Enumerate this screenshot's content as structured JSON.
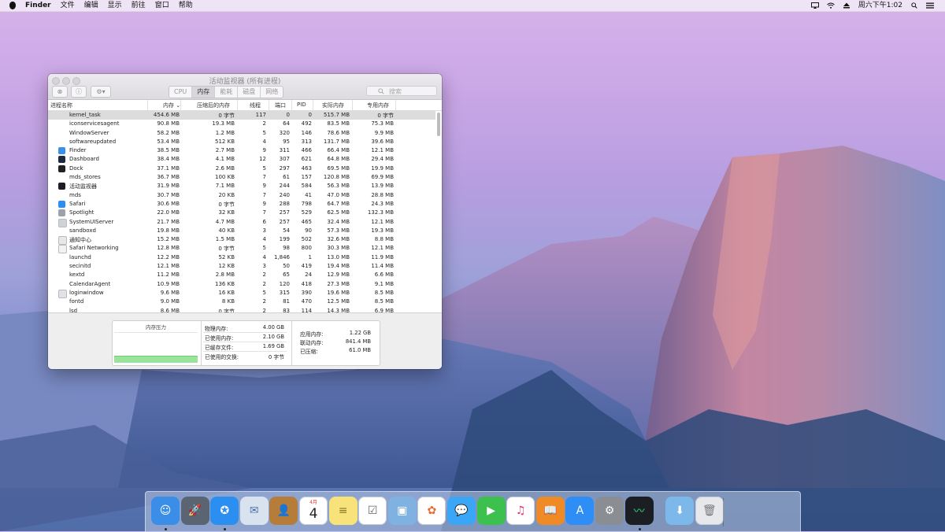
{
  "menubar": {
    "app_name": "Finder",
    "items": [
      "文件",
      "编辑",
      "显示",
      "前往",
      "窗口",
      "帮助"
    ],
    "clock": "周六下午1:02"
  },
  "window": {
    "title": "活动监视器 (所有进程)",
    "tabs": [
      {
        "label": "CPU",
        "active": false
      },
      {
        "label": "内存",
        "active": true
      },
      {
        "label": "能耗",
        "active": false
      },
      {
        "label": "磁盘",
        "active": false
      },
      {
        "label": "网络",
        "active": false
      }
    ],
    "search_placeholder": "搜索"
  },
  "table": {
    "columns": [
      "进程名称",
      "内存",
      "压缩后的内存",
      "线程",
      "端口",
      "PID",
      "实际内存",
      "专用内存"
    ],
    "rows": [
      {
        "name": "kernel_task",
        "mem": "454.6 MB",
        "comp": "0 字节",
        "threads": "117",
        "ports": "0",
        "pid": "0",
        "real": "515.7 MB",
        "priv": "0 字节",
        "selected": true,
        "icon": ""
      },
      {
        "name": "iconservicesagent",
        "mem": "90.8 MB",
        "comp": "19.3 MB",
        "threads": "2",
        "ports": "64",
        "pid": "492",
        "real": "83.5 MB",
        "priv": "75.3 MB",
        "icon": ""
      },
      {
        "name": "WindowServer",
        "mem": "58.2 MB",
        "comp": "1.2 MB",
        "threads": "5",
        "ports": "320",
        "pid": "146",
        "real": "78.6 MB",
        "priv": "9.9 MB",
        "icon": ""
      },
      {
        "name": "softwareupdated",
        "mem": "53.4 MB",
        "comp": "512 KB",
        "threads": "4",
        "ports": "95",
        "pid": "313",
        "real": "131.7 MB",
        "priv": "39.6 MB",
        "icon": ""
      },
      {
        "name": "Finder",
        "mem": "38.5 MB",
        "comp": "2.7 MB",
        "threads": "9",
        "ports": "311",
        "pid": "466",
        "real": "66.4 MB",
        "priv": "12.1 MB",
        "icon": "finder"
      },
      {
        "name": "Dashboard",
        "mem": "38.4 MB",
        "comp": "4.1 MB",
        "threads": "12",
        "ports": "307",
        "pid": "621",
        "real": "64.8 MB",
        "priv": "29.4 MB",
        "icon": "dashboard"
      },
      {
        "name": "Dock",
        "mem": "37.1 MB",
        "comp": "2.6 MB",
        "threads": "5",
        "ports": "297",
        "pid": "463",
        "real": "69.5 MB",
        "priv": "19.9 MB",
        "icon": "dock"
      },
      {
        "name": "mds_stores",
        "mem": "36.7 MB",
        "comp": "100 KB",
        "threads": "7",
        "ports": "61",
        "pid": "157",
        "real": "120.8 MB",
        "priv": "69.9 MB",
        "icon": ""
      },
      {
        "name": "活动监视器",
        "mem": "31.9 MB",
        "comp": "7.1 MB",
        "threads": "9",
        "ports": "244",
        "pid": "584",
        "real": "56.3 MB",
        "priv": "13.9 MB",
        "icon": "activity"
      },
      {
        "name": "mds",
        "mem": "30.7 MB",
        "comp": "20 KB",
        "threads": "7",
        "ports": "240",
        "pid": "41",
        "real": "47.0 MB",
        "priv": "28.8 MB",
        "icon": ""
      },
      {
        "name": "Safari",
        "mem": "30.6 MB",
        "comp": "0 字节",
        "threads": "9",
        "ports": "288",
        "pid": "798",
        "real": "64.7 MB",
        "priv": "24.3 MB",
        "icon": "safari"
      },
      {
        "name": "Spotlight",
        "mem": "22.0 MB",
        "comp": "32 KB",
        "threads": "7",
        "ports": "257",
        "pid": "529",
        "real": "62.5 MB",
        "priv": "132.3 MB",
        "icon": "spotlight"
      },
      {
        "name": "SystemUIServer",
        "mem": "21.7 MB",
        "comp": "4.7 MB",
        "threads": "6",
        "ports": "257",
        "pid": "465",
        "real": "32.4 MB",
        "priv": "12.1 MB",
        "icon": "system"
      },
      {
        "name": "sandboxd",
        "mem": "19.8 MB",
        "comp": "40 KB",
        "threads": "3",
        "ports": "54",
        "pid": "90",
        "real": "57.3 MB",
        "priv": "19.3 MB",
        "icon": ""
      },
      {
        "name": "通知中心",
        "mem": "15.2 MB",
        "comp": "1.5 MB",
        "threads": "4",
        "ports": "199",
        "pid": "502",
        "real": "32.6 MB",
        "priv": "8.8 MB",
        "icon": "notification"
      },
      {
        "name": "Safari Networking",
        "mem": "12.8 MB",
        "comp": "0 字节",
        "threads": "5",
        "ports": "98",
        "pid": "800",
        "real": "30.3 MB",
        "priv": "12.1 MB",
        "icon": "shield"
      },
      {
        "name": "launchd",
        "mem": "12.2 MB",
        "comp": "52 KB",
        "threads": "4",
        "ports": "1,846",
        "pid": "1",
        "real": "13.0 MB",
        "priv": "11.9 MB",
        "icon": ""
      },
      {
        "name": "secinitd",
        "mem": "12.1 MB",
        "comp": "12 KB",
        "threads": "3",
        "ports": "50",
        "pid": "419",
        "real": "19.4 MB",
        "priv": "11.4 MB",
        "icon": ""
      },
      {
        "name": "kextd",
        "mem": "11.2 MB",
        "comp": "2.8 MB",
        "threads": "2",
        "ports": "65",
        "pid": "24",
        "real": "12.9 MB",
        "priv": "6.6 MB",
        "icon": ""
      },
      {
        "name": "CalendarAgent",
        "mem": "10.9 MB",
        "comp": "136 KB",
        "threads": "2",
        "ports": "120",
        "pid": "418",
        "real": "27.3 MB",
        "priv": "9.1 MB",
        "icon": ""
      },
      {
        "name": "loginwindow",
        "mem": "9.6 MB",
        "comp": "16 KB",
        "threads": "5",
        "ports": "315",
        "pid": "390",
        "real": "19.6 MB",
        "priv": "8.5 MB",
        "icon": "login"
      },
      {
        "name": "fontd",
        "mem": "9.0 MB",
        "comp": "8 KB",
        "threads": "2",
        "ports": "81",
        "pid": "470",
        "real": "12.5 MB",
        "priv": "8.5 MB",
        "icon": ""
      },
      {
        "name": "lsd",
        "mem": "8.6 MB",
        "comp": "0 字节",
        "threads": "2",
        "ports": "83",
        "pid": "114",
        "real": "14.3 MB",
        "priv": "6.9 MB",
        "icon": ""
      }
    ]
  },
  "footer": {
    "pressure_label": "内存压力",
    "pressure_level": 0.22,
    "pressure_color": "#9ae39a",
    "left_stats": [
      {
        "label": "物理内存:",
        "value": "4.00 GB"
      },
      {
        "label": "已使用内存:",
        "value": "2.10 GB"
      },
      {
        "label": "已缓存文件:",
        "value": "1.69 GB"
      },
      {
        "label": "已使用的交换:",
        "value": "0 字节"
      }
    ],
    "right_stats": [
      {
        "label": "应用内存:",
        "value": "1.22 GB"
      },
      {
        "label": "联动内存:",
        "value": "841.4 MB"
      },
      {
        "label": "已压缩:",
        "value": "61.0 MB"
      }
    ]
  },
  "dock": {
    "calendar_month": "4月",
    "calendar_day": "4",
    "apps": [
      {
        "name": "finder-icon",
        "color": "#3b8ee8"
      },
      {
        "name": "launchpad-icon",
        "color": "#5b6472"
      },
      {
        "name": "safari-icon",
        "color": "#2a8ff0"
      },
      {
        "name": "mail-icon",
        "color": "#d9e3ef"
      },
      {
        "name": "contacts-icon",
        "color": "#b57c3a"
      },
      {
        "name": "calendar-icon",
        "color": "#ffffff"
      },
      {
        "name": "notes-icon",
        "color": "#f7e37a"
      },
      {
        "name": "reminders-icon",
        "color": "#ffffff"
      },
      {
        "name": "preview-icon",
        "color": "#7fb2e0"
      },
      {
        "name": "photos-icon",
        "color": "#ffffff"
      },
      {
        "name": "messages-icon",
        "color": "#3aa6f5"
      },
      {
        "name": "facetime-icon",
        "color": "#3cc14f"
      },
      {
        "name": "itunes-icon",
        "color": "#ffffff"
      },
      {
        "name": "ibooks-icon",
        "color": "#f08a24"
      },
      {
        "name": "appstore-icon",
        "color": "#2f8ef5"
      },
      {
        "name": "system-preferences-icon",
        "color": "#8a8d92"
      },
      {
        "name": "activity-monitor-icon",
        "color": "#1b1f24"
      },
      {
        "name": "downloads-folder-icon",
        "color": "#7cb8ea"
      },
      {
        "name": "trash-icon",
        "color": "#e6e8ec"
      }
    ]
  }
}
